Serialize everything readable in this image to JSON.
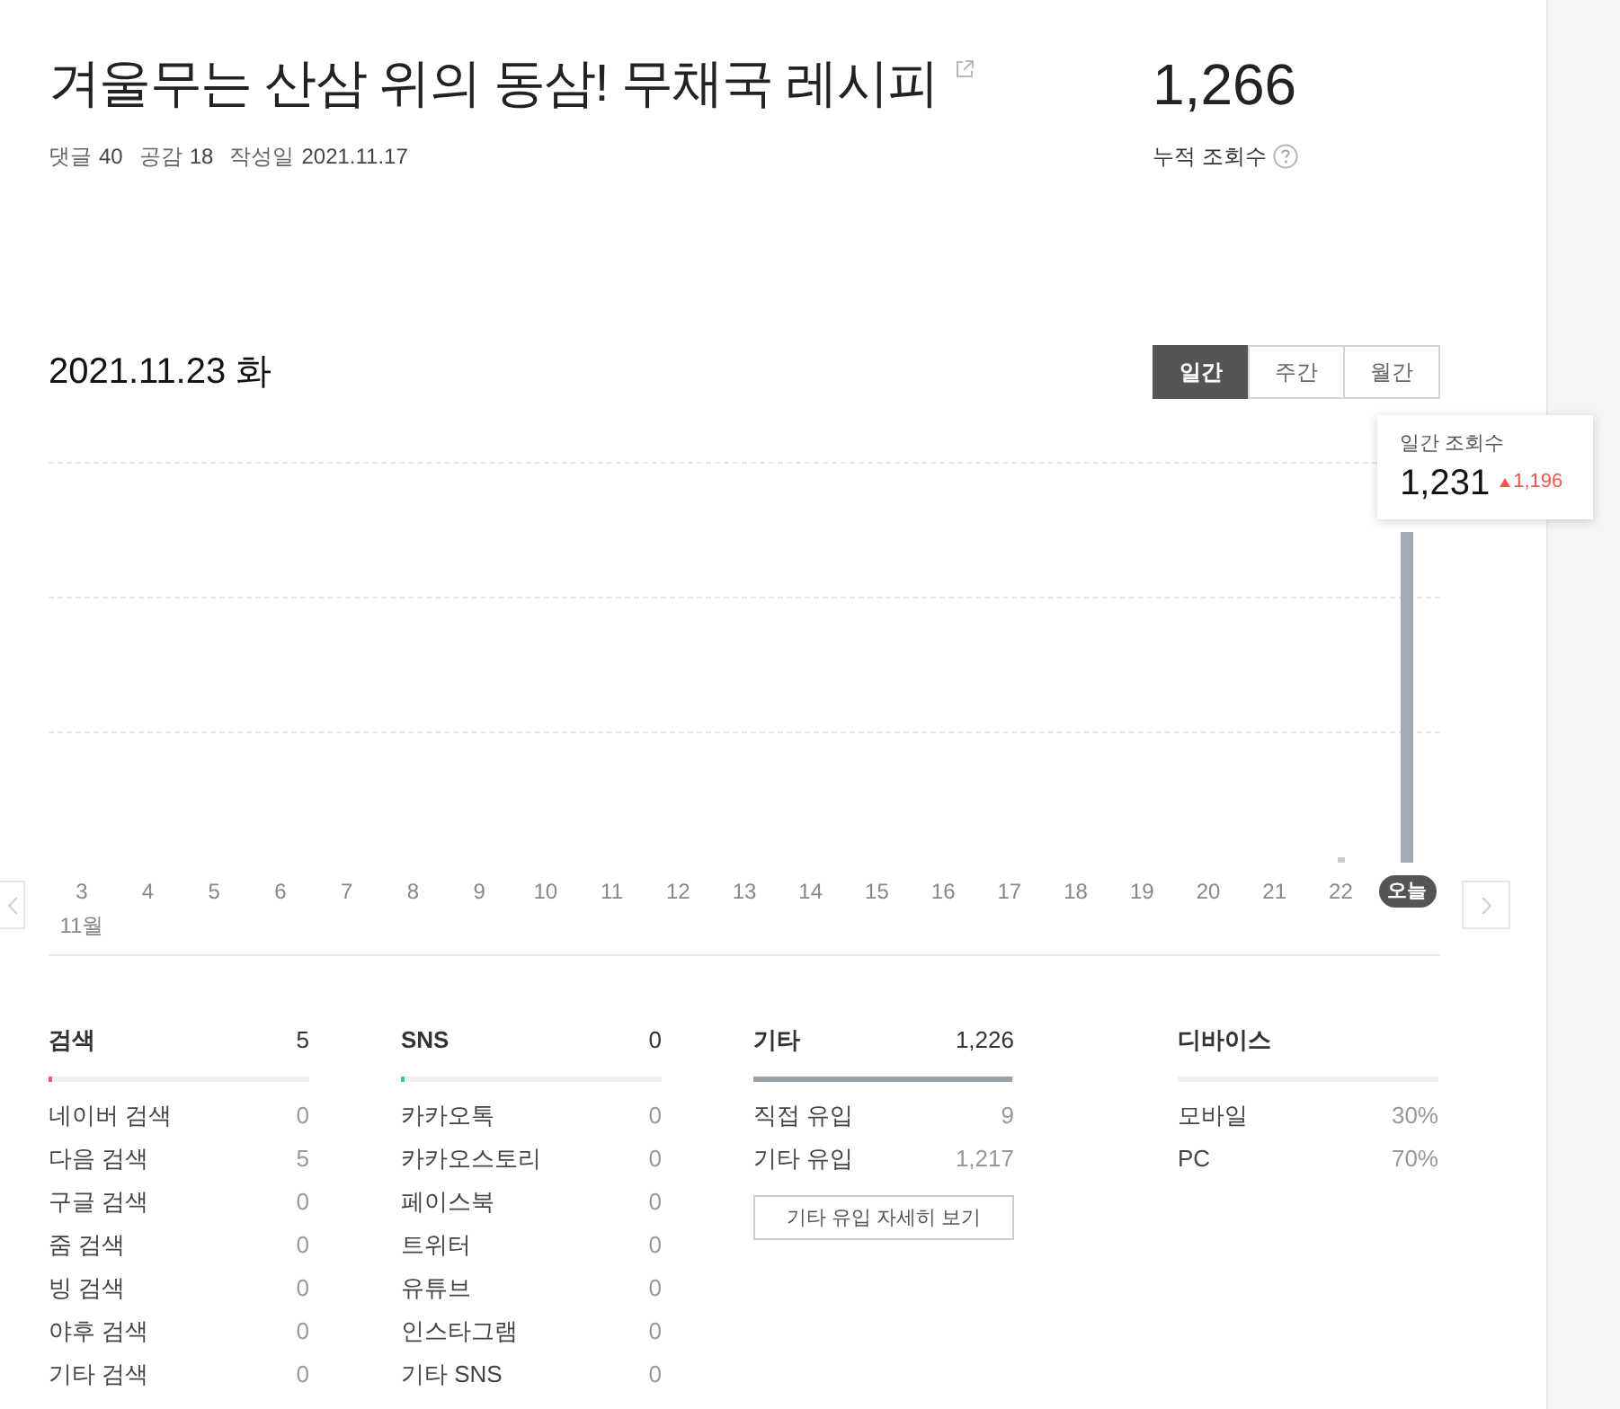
{
  "post": {
    "title": "겨울무는 산삼 위의 동삼! 무채국 레시피",
    "meta": [
      {
        "label": "댓글",
        "value": "40"
      },
      {
        "label": "공감",
        "value": "18"
      },
      {
        "label": "작성일",
        "value": "2021.11.17"
      }
    ]
  },
  "total_views": {
    "value": "1,266",
    "label": "누적 조회수"
  },
  "chart": {
    "date": "2021.11.23 화",
    "period_tabs": [
      {
        "label": "일간",
        "selected": true
      },
      {
        "label": "주간",
        "selected": false
      },
      {
        "label": "월간",
        "selected": false
      }
    ],
    "tooltip": {
      "label": "일간 조회수",
      "value": "1,231",
      "change": "1,196"
    },
    "days": [
      {
        "label": "3",
        "selected": false
      },
      {
        "label": "4",
        "selected": false
      },
      {
        "label": "5",
        "selected": false
      },
      {
        "label": "6",
        "selected": false
      },
      {
        "label": "7",
        "selected": false
      },
      {
        "label": "8",
        "selected": false
      },
      {
        "label": "9",
        "selected": false
      },
      {
        "label": "10",
        "selected": false
      },
      {
        "label": "11",
        "selected": false
      },
      {
        "label": "12",
        "selected": false
      },
      {
        "label": "13",
        "selected": false
      },
      {
        "label": "14",
        "selected": false
      },
      {
        "label": "15",
        "selected": false
      },
      {
        "label": "16",
        "selected": false
      },
      {
        "label": "17",
        "selected": false
      },
      {
        "label": "18",
        "selected": false
      },
      {
        "label": "19",
        "selected": false
      },
      {
        "label": "20",
        "selected": false
      },
      {
        "label": "21",
        "selected": false
      },
      {
        "label": "22",
        "selected": false
      },
      {
        "label": "오늘",
        "selected": true
      }
    ],
    "month_label": "11월"
  },
  "sections": [
    {
      "kind": "source",
      "title": "검색",
      "total": "5",
      "level": 0.004,
      "color": "#f0566f",
      "rows": [
        {
          "label": "네이버 검색",
          "value": "0"
        },
        {
          "label": "다음 검색",
          "value": "5"
        },
        {
          "label": "구글 검색",
          "value": "0"
        },
        {
          "label": "줌 검색",
          "value": "0"
        },
        {
          "label": "빙 검색",
          "value": "0"
        },
        {
          "label": "야후 검색",
          "value": "0"
        },
        {
          "label": "기타 검색",
          "value": "0"
        }
      ]
    },
    {
      "kind": "source",
      "title": "SNS",
      "total": "0",
      "level": 0,
      "color": "#2ec4b6",
      "rows": [
        {
          "label": "카카오톡",
          "value": "0"
        },
        {
          "label": "카카오스토리",
          "value": "0"
        },
        {
          "label": "페이스북",
          "value": "0"
        },
        {
          "label": "트위터",
          "value": "0"
        },
        {
          "label": "유튜브",
          "value": "0"
        },
        {
          "label": "인스타그램",
          "value": "0"
        },
        {
          "label": "기타 SNS",
          "value": "0"
        }
      ]
    },
    {
      "kind": "source",
      "title": "기타",
      "total": "1,226",
      "level": 0.996,
      "color": "#9aa0aa",
      "rows": [
        {
          "label": "직접 유입",
          "value": "9"
        },
        {
          "label": "기타 유입",
          "value": "1,217"
        }
      ],
      "button": "기타 유입 자세히 보기"
    },
    {
      "kind": "device",
      "title": "디바이스",
      "rows": [
        {
          "label": "모바일",
          "value": "30%"
        },
        {
          "label": "PC",
          "value": "70%"
        }
      ]
    }
  ]
}
